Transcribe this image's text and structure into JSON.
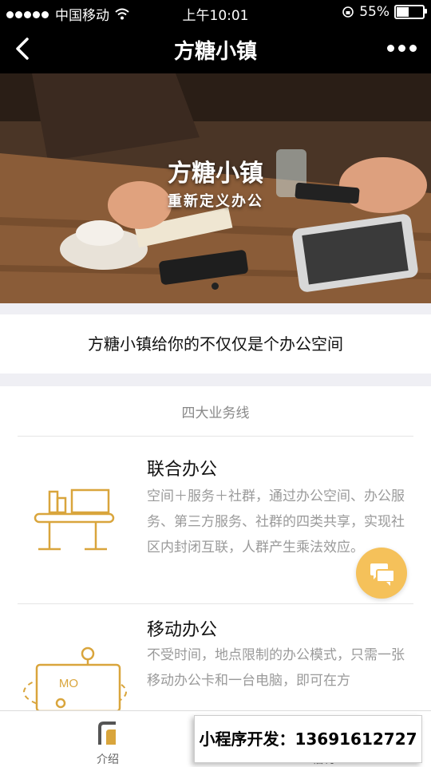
{
  "status_bar": {
    "carrier": "中国移动",
    "time": "上午10:01",
    "battery_percent": "55%",
    "battery_level": 0.55
  },
  "nav": {
    "title": "方糖小镇"
  },
  "banner": {
    "title": "方糖小镇",
    "subtitle": "重新定义办公"
  },
  "tagline": "方糖小镇给你的不仅仅是个办公空间",
  "business": {
    "heading": "四大业务线",
    "items": [
      {
        "title": "联合办公",
        "desc": "空间＋服务＋社群，通过办公空间、办公服务、第三方服务、社群的四类共享，实现社区内封闭互联，人群产生乘法效应。"
      },
      {
        "title": "移动办公",
        "desc": "不受时间，地点限制的办公模式，只需一张移动办公卡和一台电脑，即可在方",
        "icon_text": "MO"
      }
    ]
  },
  "tabbar": {
    "tabs": [
      {
        "label": "介绍"
      },
      {
        "label": "福利"
      }
    ]
  },
  "promo": {
    "text": "小程序开发：13691612727"
  },
  "colors": {
    "accent": "#d9a53c",
    "fab": "#f5c15a"
  }
}
